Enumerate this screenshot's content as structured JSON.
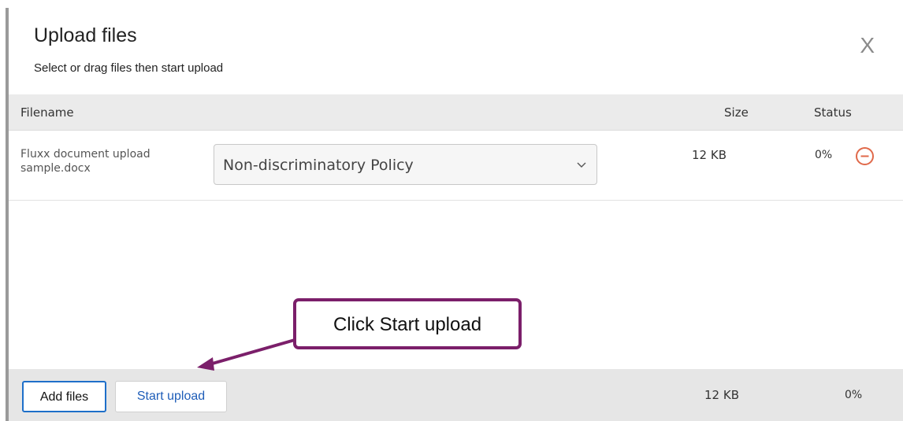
{
  "dialog": {
    "title": "Upload files",
    "subtitle": "Select or drag files then start upload",
    "close_label": "X"
  },
  "table": {
    "columns": {
      "filename": "Filename",
      "size": "Size",
      "status": "Status"
    },
    "rows": [
      {
        "filename_line1": "Fluxx document upload",
        "filename_line2": "sample.docx",
        "document_type": "Non-discriminatory Policy",
        "size": "12 KB",
        "status": "0%"
      }
    ]
  },
  "footer": {
    "add_files_label": "Add files",
    "start_upload_label": "Start upload",
    "total_size": "12 KB",
    "total_status": "0%"
  },
  "annotation": {
    "callout_text": "Click Start upload"
  },
  "colors": {
    "accent_blue": "#1e6fc9",
    "remove_icon": "#e0694a",
    "callout_border": "#7b1f6a"
  },
  "icons": {
    "close": "close-icon",
    "select_chevron": "chevron-down-icon",
    "remove": "remove-circle-icon"
  }
}
